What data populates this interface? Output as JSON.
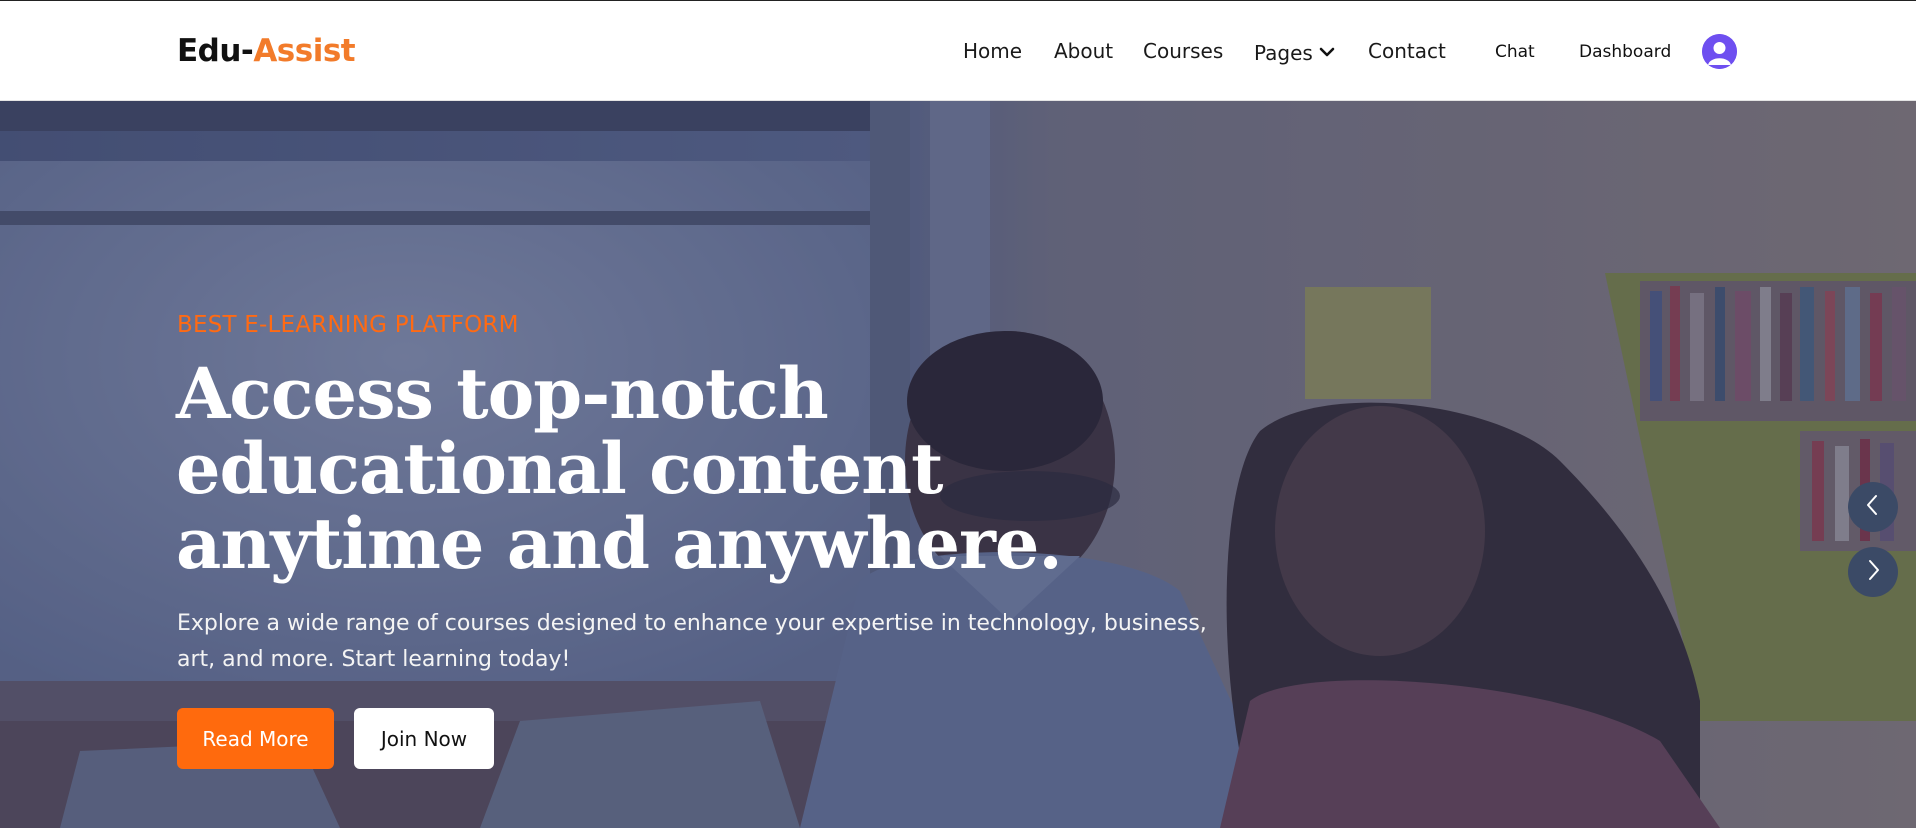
{
  "brand": {
    "part1": "Edu-",
    "part2": "Assist"
  },
  "nav": {
    "home": "Home",
    "about": "About",
    "courses": "Courses",
    "pages": "Pages",
    "contact": "Contact",
    "chat": "Chat",
    "dashboard": "Dashboard"
  },
  "hero": {
    "eyebrow": "BEST E-LEARNING PLATFORM",
    "headline_line1": "Access top-notch",
    "headline_line2": "educational content",
    "headline_line3": "anytime and anywhere.",
    "subtext": "Explore a wide range of courses designed to enhance your expertise in technology, business, art, and more. Start learning today!",
    "read_more": "Read More",
    "join_now": "Join Now"
  },
  "colors": {
    "accent": "#ff6a0d",
    "brand_accent": "#f27b2a",
    "avatar": "#6e4ff0"
  },
  "icons": {
    "pages_dropdown": "chevron-down-icon",
    "avatar": "user-avatar-icon",
    "prev": "chevron-left-icon",
    "next": "chevron-right-icon"
  }
}
